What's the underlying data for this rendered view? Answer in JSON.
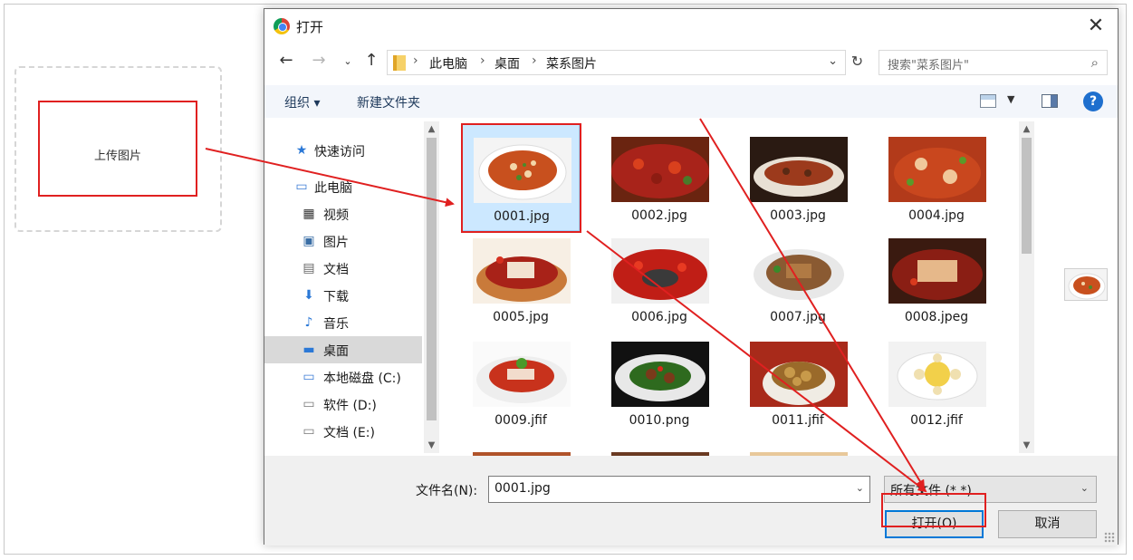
{
  "page": {
    "upload_label": "上传图片"
  },
  "dialog": {
    "title": "打开",
    "breadcrumb": [
      "此电脑",
      "桌面",
      "菜系图片"
    ],
    "search_placeholder": "搜索\"菜系图片\"",
    "toolbar": {
      "organize": "组织 ▾",
      "new_folder": "新建文件夹"
    },
    "nav_items": [
      {
        "label": "快速访问",
        "icon": "star-icon"
      },
      {
        "label": "此电脑",
        "icon": "computer-icon"
      },
      {
        "label": "视频",
        "icon": "video-icon"
      },
      {
        "label": "图片",
        "icon": "pictures-icon"
      },
      {
        "label": "文档",
        "icon": "documents-icon"
      },
      {
        "label": "下载",
        "icon": "download-icon"
      },
      {
        "label": "音乐",
        "icon": "music-icon"
      },
      {
        "label": "桌面",
        "icon": "desktop-icon",
        "selected": true
      },
      {
        "label": "本地磁盘 (C:)",
        "icon": "drive-icon"
      },
      {
        "label": "软件 (D:)",
        "icon": "drive-icon"
      },
      {
        "label": "文档 (E:)",
        "icon": "drive-icon"
      }
    ],
    "files": [
      {
        "name": "0001.jpg",
        "selected": true
      },
      {
        "name": "0002.jpg"
      },
      {
        "name": "0003.jpg"
      },
      {
        "name": "0004.jpg"
      },
      {
        "name": "0005.jpg"
      },
      {
        "name": "0006.jpg"
      },
      {
        "name": "0007.jpg"
      },
      {
        "name": "0008.jpeg"
      },
      {
        "name": "0009.jfif"
      },
      {
        "name": "0010.png"
      },
      {
        "name": "0011.jfif"
      },
      {
        "name": "0012.jfif"
      }
    ],
    "filename_label": "文件名(N):",
    "filename_value": "0001.jpg",
    "filetype_value": "所有文件 (*.*)",
    "open_button": "打开(O)",
    "cancel_button": "取消"
  },
  "colors": {
    "annotation_red": "#e02020",
    "accent": "#0078d7",
    "selection": "#cce8ff"
  }
}
